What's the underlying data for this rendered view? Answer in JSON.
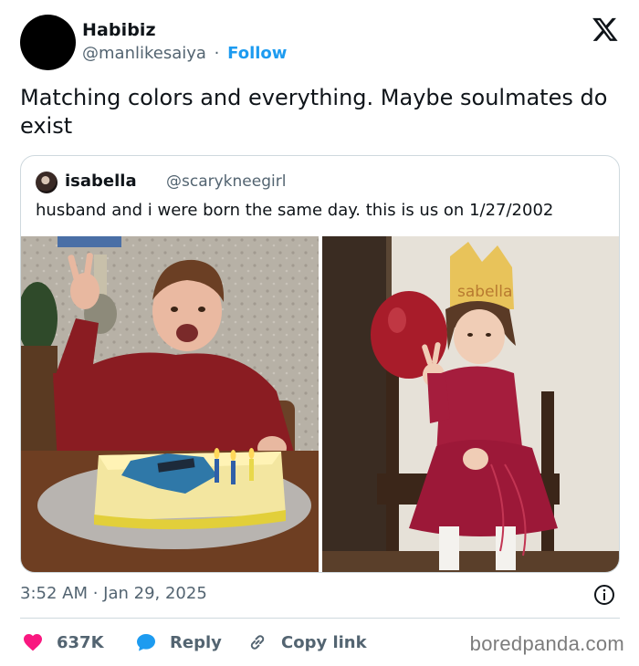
{
  "author": {
    "name": "Habibiz",
    "handle": "@manlikesaiya",
    "separator": "·",
    "follow_label": "Follow"
  },
  "tweet": {
    "text": "Matching colors and everything. Maybe soulmates do exist",
    "timestamp": "3:52 AM · Jan 29, 2025"
  },
  "quote": {
    "name": "isabella",
    "handle": "@scarykneegirl",
    "text": "husband and i were born the same day. this is us on 1/27/2002",
    "crown_text": "sabella"
  },
  "actions": {
    "likes": "637K",
    "reply_label": "Reply",
    "copy_label": "Copy link"
  },
  "watermark": "boredpanda.com",
  "colors": {
    "accent_blue": "#1d9bf0",
    "like_red": "#f91880",
    "text_secondary": "#536471",
    "border": "#cfd9de"
  },
  "icons": {
    "platform": "x-logo-icon",
    "like": "heart-icon",
    "reply": "reply-bubble-icon",
    "copy": "link-icon",
    "info": "info-icon"
  }
}
